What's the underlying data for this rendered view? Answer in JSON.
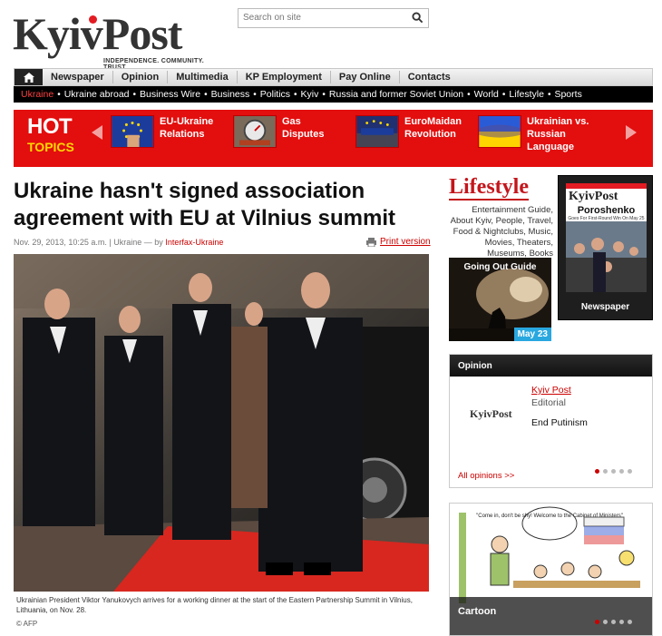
{
  "brand": {
    "name": "KyivPost",
    "tagline": "INDEPENDENCE. COMMUNITY. TRUST"
  },
  "search": {
    "placeholder": "Search on site"
  },
  "nav_main": [
    "Newspaper",
    "Opinion",
    "Multimedia",
    "KP Employment",
    "Pay Online",
    "Contacts"
  ],
  "nav_sub": [
    "Ukraine",
    "Ukraine abroad",
    "Business Wire",
    "Business",
    "Politics",
    "Kyiv",
    "Russia and former Soviet Union",
    "World",
    "Lifestyle",
    "Sports"
  ],
  "hot_topics": {
    "label_hot": "HOT",
    "label_topics": "TOPICS",
    "items": [
      "EU-Ukraine Relations",
      "Gas Disputes",
      "EuroMaidan Revolution",
      "Ukrainian vs. Russian Language"
    ]
  },
  "article": {
    "headline": "Ukraine hasn't signed association agreement with EU at Vilnius summit",
    "date": "Nov. 29, 2013, 10:25 a.m.",
    "section": "Ukraine",
    "by": "— by",
    "source": "Interfax-Ukraine",
    "print_label": "Print version",
    "caption": "Ukrainian President Viktor Yanukovych arrives for a working dinner at the start of the Eastern Partnership Summit in Vilnius, Lithuania, on Nov. 28.",
    "credit": "© AFP"
  },
  "lifestyle": {
    "title": "Lifestyle",
    "desc": "Entertainment Guide, About Kyiv, People, Travel, Food & Nightclubs, Music, Movies, Theaters, Museums, Books",
    "guide_label": "Going Out Guide",
    "guide_date": "May 23"
  },
  "newspaper": {
    "label": "Newspaper",
    "cover_masthead": "KyivPost",
    "cover_headline": "Poroshenko",
    "cover_sub": "Goes For First-Round Win On May 25"
  },
  "opinion": {
    "header": "Opinion",
    "logo": "KyivPost",
    "author": "Kyiv Post",
    "role": "Editorial",
    "title": "End Putinism",
    "all_link": "All opinions >>"
  },
  "cartoon": {
    "label": "Cartoon",
    "bubble": "\"Come in, don't be shy! Welcome to the Cabinet of Ministers\""
  },
  "colors": {
    "brand_red": "#e30e0e",
    "link_red": "#cc0000",
    "nav_black": "#000000",
    "accent_blue": "#29a8e0"
  }
}
